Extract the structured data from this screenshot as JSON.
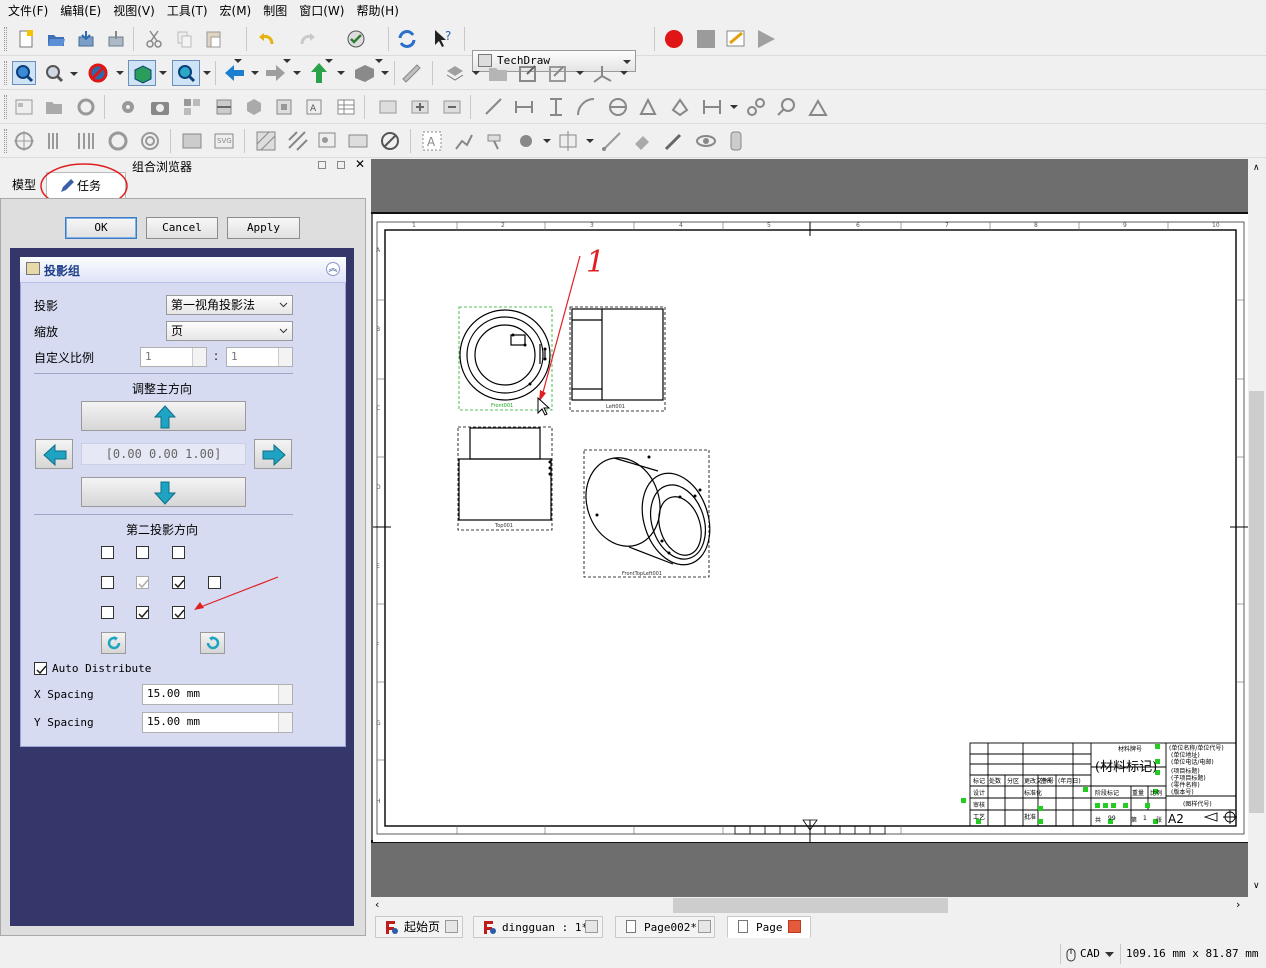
{
  "menubar": {
    "items": [
      "文件(F)",
      "编辑(E)",
      "视图(V)",
      "工具(T)",
      "宏(M)",
      "制图",
      "窗口(W)",
      "帮助(H)"
    ]
  },
  "toolbar": {
    "workbench": "TechDraw"
  },
  "combo_view": {
    "title": "组合浏览器",
    "tabs": {
      "model": "模型",
      "tasks": "任务"
    }
  },
  "dialog": {
    "ok": "OK",
    "cancel": "Cancel",
    "apply": "Apply"
  },
  "projection_group": {
    "title": "投影组",
    "projection_label": "投影",
    "projection_value": "第一视角投影法",
    "scale_label": "缩放",
    "scale_value": "页",
    "custom_scale_label": "自定义比例",
    "custom_scale_num": "1",
    "custom_scale_sep": ":",
    "custom_scale_den": "1",
    "primary_dir_title": "调整主方向",
    "primary_dir_value": "[0.00 0.00 1.00]",
    "secondary_dir_title": "第二投影方向",
    "auto_distribute_label": "Auto Distribute",
    "auto_distribute_checked": true,
    "x_spacing_label": "X Spacing",
    "x_spacing_value": "15.00 mm",
    "y_spacing_label": "Y Spacing",
    "y_spacing_value": "15.00 mm",
    "secondary_checkboxes": [
      [
        false,
        false,
        false,
        null
      ],
      [
        false,
        true,
        true,
        false
      ],
      [
        false,
        true,
        true,
        null
      ]
    ]
  },
  "drawing": {
    "view_labels": [
      "Front001",
      "Left001",
      "Top001",
      "FrontTopLeft001"
    ],
    "title_block": {
      "material_mark": "材料牌号",
      "material": "(材料标记)",
      "unit_name": "(单位名称/单位代号)",
      "unit_address": "(单位地址)",
      "unit_phone": "(单位电话/电邮)",
      "project_title": "(项目标题)",
      "subproject": "(子项目标题)",
      "part_name": "(零件名称)",
      "version": "(版本号)",
      "drawing_code": "(图样代号)",
      "sheet_size": "A2",
      "row_labels": [
        "标记",
        "处数",
        "分区",
        "更改文件号",
        "签名",
        "(年月日)"
      ],
      "design": "设计",
      "check": "审核",
      "process": "工艺",
      "standard": "标准化",
      "approve": "批准",
      "stage": "阶段标记",
      "weight": "重量",
      "scale": "比例",
      "total": "共",
      "sheets": "99",
      "page": "第",
      "page_no": "1",
      "sheet_unit": "张"
    },
    "border_numbers": [
      "1",
      "2",
      "3",
      "4",
      "5",
      "6",
      "7",
      "8",
      "9",
      "10"
    ],
    "border_letters": [
      "A",
      "B",
      "C",
      "D",
      "E",
      "F",
      "G",
      "H"
    ]
  },
  "annotations": {
    "handwritten": "1"
  },
  "doc_tabs": [
    "起始页",
    "dingguan : 1*",
    "Page002*",
    "Page"
  ],
  "statusbar": {
    "nav_style": "CAD",
    "dimensions": "109.16 mm x 81.87 mm"
  },
  "colors": {
    "accent_red": "#e02020",
    "task_panel_bg": "#35376a",
    "view_frame_green": "#22aa22"
  }
}
